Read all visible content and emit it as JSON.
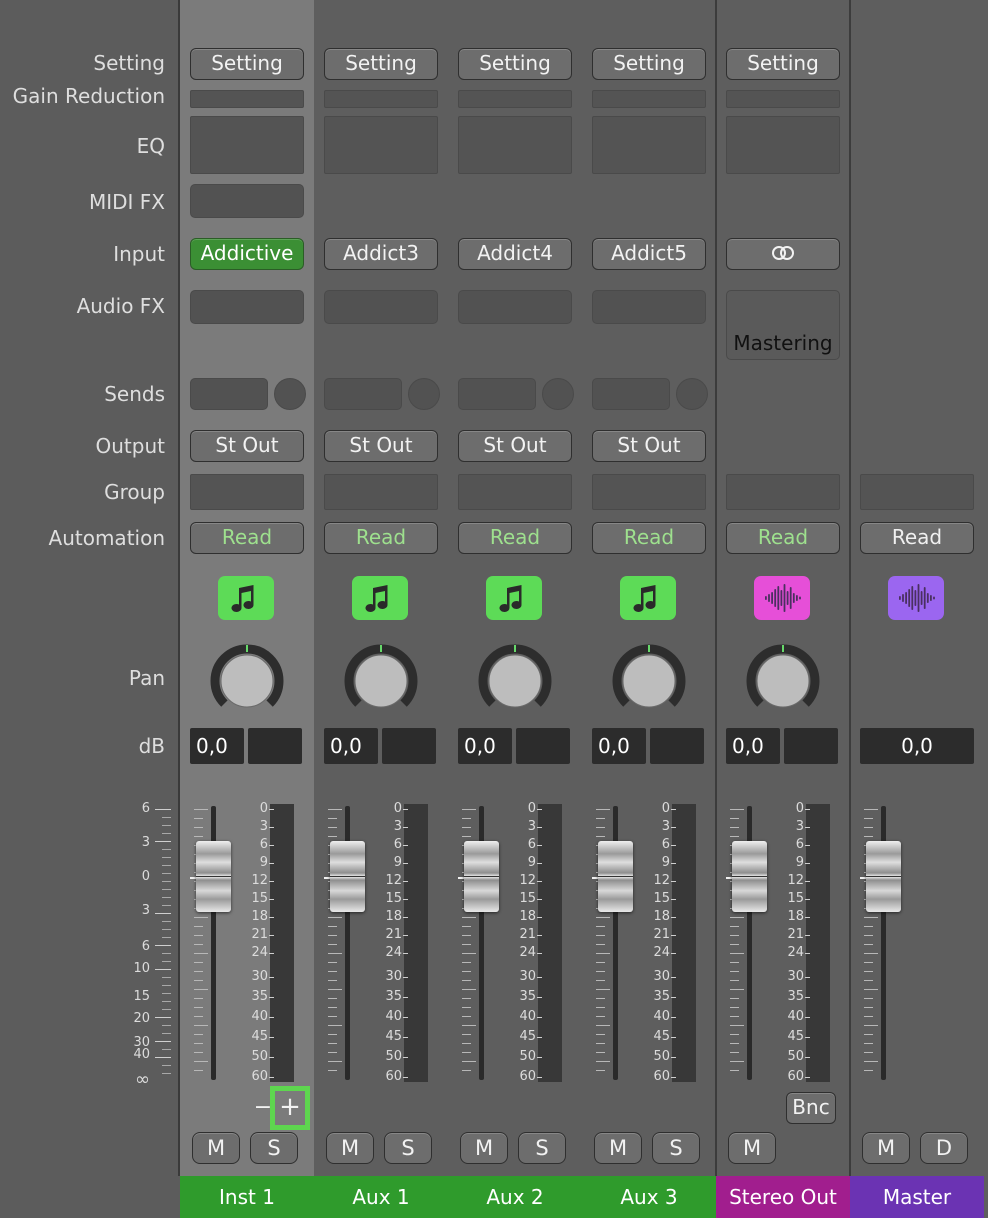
{
  "row_labels": {
    "setting": "Setting",
    "gain_reduction": "Gain Reduction",
    "eq": "EQ",
    "midi_fx": "MIDI FX",
    "input": "Input",
    "audio_fx": "Audio FX",
    "sends": "Sends",
    "output": "Output",
    "group": "Group",
    "automation": "Automation",
    "pan": "Pan",
    "db": "dB"
  },
  "fader_scale_labels": [
    "6",
    "3",
    "0",
    "3",
    "6",
    "10",
    "15",
    "20",
    "30",
    "40",
    "∞"
  ],
  "meter_scale_labels": [
    "0",
    "3",
    "6",
    "9",
    "12",
    "15",
    "18",
    "21",
    "24",
    "30",
    "35",
    "40",
    "45",
    "50",
    "60"
  ],
  "colors": {
    "inst_green": "#2f9b2c",
    "track_icon_green": "#5ddb57",
    "stereo_out": "#a11e8e",
    "stereo_icon": "#e64fd8",
    "master": "#6b33b3",
    "master_icon": "#9b66f0",
    "read_green": "#9ee08e",
    "highlight": "#5ed64f"
  },
  "strips": [
    {
      "name": "Inst 1",
      "setting": "Setting",
      "input": "Addictive",
      "audio_fx": "",
      "output": "St Out",
      "automation": "Read",
      "icon": "music-note-icon",
      "volume": "0,0",
      "mute": "M",
      "solo": "S",
      "zoom_minus": "−",
      "zoom_plus": "+",
      "selected": true
    },
    {
      "name": "Aux 1",
      "setting": "Setting",
      "input": "Addict3",
      "audio_fx": "",
      "output": "St Out",
      "automation": "Read",
      "icon": "music-note-icon",
      "volume": "0,0",
      "mute": "M",
      "solo": "S"
    },
    {
      "name": "Aux 2",
      "setting": "Setting",
      "input": "Addict4",
      "audio_fx": "",
      "output": "St Out",
      "automation": "Read",
      "icon": "music-note-icon",
      "volume": "0,0",
      "mute": "M",
      "solo": "S"
    },
    {
      "name": "Aux 3",
      "setting": "Setting",
      "input": "Addict5",
      "audio_fx": "",
      "output": "St Out",
      "automation": "Read",
      "icon": "music-note-icon",
      "volume": "0,0",
      "mute": "M",
      "solo": "S"
    },
    {
      "name": "Stereo Out",
      "setting": "Setting",
      "input": "",
      "input_icon": "stereo-link-icon",
      "audio_fx": "Mastering",
      "output": "",
      "automation": "Read",
      "icon": "waveform-icon",
      "volume": "0,0",
      "mute": "M",
      "bounce": "Bnc"
    },
    {
      "name": "Master",
      "automation": "Read",
      "icon": "waveform-icon",
      "volume": "0,0",
      "mute": "M",
      "dim": "D"
    }
  ]
}
